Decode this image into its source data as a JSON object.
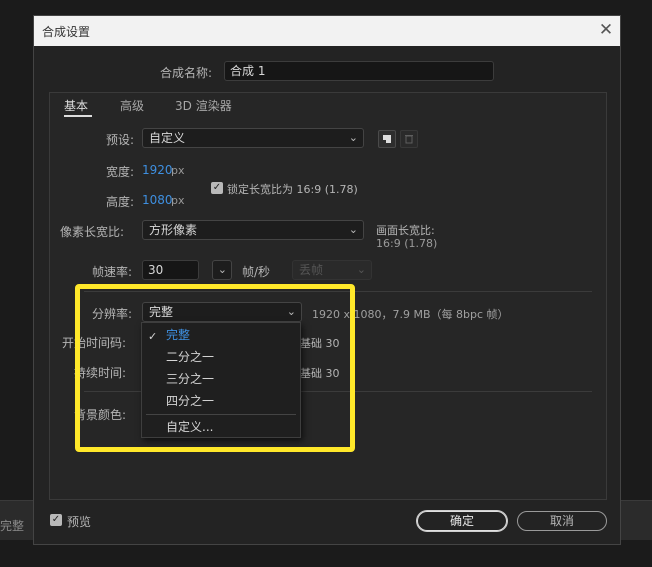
{
  "background": {
    "strip_label": "完整"
  },
  "dialog": {
    "title": "合成设置",
    "close_glyph": "✕",
    "comp_name_label": "合成名称:",
    "comp_name_value": "合成 1",
    "tabs": [
      {
        "label": "基本"
      },
      {
        "label": "高级"
      },
      {
        "label": "3D 渲染器"
      }
    ],
    "preset": {
      "label": "预设:",
      "value": "自定义"
    },
    "width": {
      "label": "宽度:",
      "value": "1920",
      "unit": "px"
    },
    "height": {
      "label": "高度:",
      "value": "1080",
      "unit": "px"
    },
    "lock_aspect": {
      "label": "锁定长宽比为 16:9 (1.78)",
      "checked": true
    },
    "pixel_aspect": {
      "label": "像素长宽比:",
      "value": "方形像素"
    },
    "frame_aspect": {
      "label": "画面长宽比:",
      "value": "16:9 (1.78)"
    },
    "frame_rate": {
      "label": "帧速率:",
      "value": "30",
      "unit": "帧/秒",
      "drop_frame": "丢帧"
    },
    "resolution": {
      "label": "分辨率:",
      "value": "完整",
      "info": "1920 x 1080，7.9 MB（每 8bpc 帧）"
    },
    "start_timecode": {
      "label": "开始时间码:",
      "suffix": "基础 30"
    },
    "duration": {
      "label": "持续时间:",
      "suffix": "基础 30"
    },
    "bg_color": {
      "label": "背景颜色:"
    },
    "dropdown": {
      "items": [
        "完整",
        "二分之一",
        "三分之一",
        "四分之一"
      ],
      "custom": "自定义...",
      "selected_index": 0,
      "check": "✓"
    },
    "preview": {
      "label": "预览",
      "checked": true
    },
    "ok_label": "确定",
    "cancel_label": "取消"
  },
  "colors": {
    "accent": "#3e8fe0",
    "highlight": "#ffe82a"
  }
}
